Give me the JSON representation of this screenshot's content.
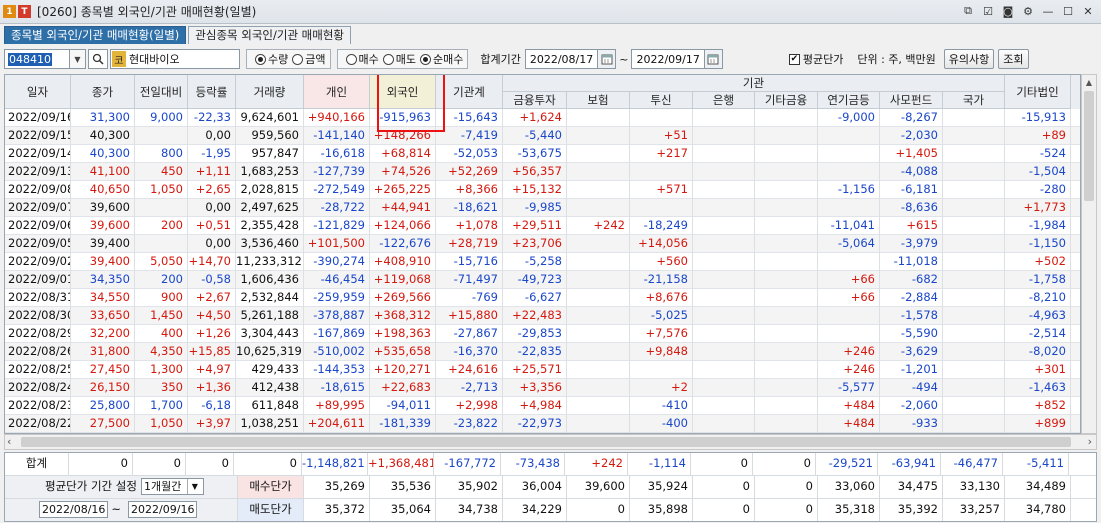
{
  "window": {
    "title": "[0260] 종목별 외국인/기관 매매현황(일별)",
    "badge1": "1",
    "badge2": "T"
  },
  "tabs": [
    {
      "label": "종목별 외국인/기관 매매현황(일별)",
      "active": true
    },
    {
      "label": "관심종목 외국인/기관 매매현황",
      "active": false
    }
  ],
  "toolbar": {
    "code": "048410",
    "stock_badge": "코",
    "stock_name": "현대바이오",
    "radio_group1": [
      {
        "label": "수량",
        "on": true
      },
      {
        "label": "금액",
        "on": false
      }
    ],
    "radio_group2": [
      {
        "label": "매수",
        "on": false
      },
      {
        "label": "매도",
        "on": false
      },
      {
        "label": "순매수",
        "on": true
      }
    ],
    "period_label": "합계기간",
    "date_from": "2022/08/17",
    "tilde": "~",
    "date_to": "2022/09/17",
    "avg_check_label": "평균단가",
    "unit_label": "단위 : 주, 백만원",
    "notice_btn": "유의사항",
    "query_btn": "조회"
  },
  "grid": {
    "group_header": "기관",
    "headers": [
      "일자",
      "종가",
      "전일대비",
      "등락률",
      "거래량",
      "개인",
      "외국인",
      "기관계",
      "금융투자",
      "보험",
      "투신",
      "은행",
      "기타금융",
      "연기금등",
      "사모펀드",
      "국가",
      "기타법인"
    ],
    "rows": [
      [
        "2022/09/16",
        "31,300",
        "9,000",
        "-22,33",
        "9,624,601",
        "+940,166",
        "-915,963",
        "-15,643",
        "+1,624",
        "",
        "",
        "",
        "",
        "-9,000",
        "-8,267",
        "",
        "-15,913"
      ],
      [
        "2022/09/15",
        "40,300",
        "",
        "0,00",
        "959,560",
        "-141,140",
        "+148,266",
        "-7,419",
        "-5,440",
        "",
        "+51",
        "",
        "",
        "",
        "-2,030",
        "",
        "+89"
      ],
      [
        "2022/09/14",
        "40,300",
        "800",
        "-1,95",
        "957,847",
        "-16,618",
        "+68,814",
        "-52,053",
        "-53,675",
        "",
        "+217",
        "",
        "",
        "",
        "+1,405",
        "",
        "-524"
      ],
      [
        "2022/09/13",
        "41,100",
        "450",
        "+1,11",
        "1,683,253",
        "-127,739",
        "+74,526",
        "+52,269",
        "+56,357",
        "",
        "",
        "",
        "",
        "",
        "-4,088",
        "",
        "-1,504"
      ],
      [
        "2022/09/08",
        "40,650",
        "1,050",
        "+2,65",
        "2,028,815",
        "-272,549",
        "+265,225",
        "+8,366",
        "+15,132",
        "",
        "+571",
        "",
        "",
        "-1,156",
        "-6,181",
        "",
        "-280"
      ],
      [
        "2022/09/07",
        "39,600",
        "",
        "0,00",
        "2,497,625",
        "-28,722",
        "+44,941",
        "-18,621",
        "-9,985",
        "",
        "",
        "",
        "",
        "",
        "-8,636",
        "",
        "+1,773"
      ],
      [
        "2022/09/06",
        "39,600",
        "200",
        "+0,51",
        "2,355,428",
        "-121,829",
        "+124,066",
        "+1,078",
        "+29,511",
        "+242",
        "-18,249",
        "",
        "",
        "-11,041",
        "+615",
        "",
        "-1,984"
      ],
      [
        "2022/09/05",
        "39,400",
        "",
        "0,00",
        "3,536,460",
        "+101,500",
        "-122,676",
        "+28,719",
        "+23,706",
        "",
        "+14,056",
        "",
        "",
        "-5,064",
        "-3,979",
        "",
        "-1,150"
      ],
      [
        "2022/09/02",
        "39,400",
        "5,050",
        "+14,70",
        "11,233,312",
        "-390,274",
        "+408,910",
        "-15,716",
        "-5,258",
        "",
        "+560",
        "",
        "",
        "",
        "-11,018",
        "",
        "+502"
      ],
      [
        "2022/09/01",
        "34,350",
        "200",
        "-0,58",
        "1,606,436",
        "-46,454",
        "+119,068",
        "-71,497",
        "-49,723",
        "",
        "-21,158",
        "",
        "",
        "+66",
        "-682",
        "",
        "-1,758"
      ],
      [
        "2022/08/31",
        "34,550",
        "900",
        "+2,67",
        "2,532,844",
        "-259,959",
        "+269,566",
        "-769",
        "-6,627",
        "",
        "+8,676",
        "",
        "",
        "+66",
        "-2,884",
        "",
        "-8,210"
      ],
      [
        "2022/08/30",
        "33,650",
        "1,450",
        "+4,50",
        "5,261,188",
        "-378,887",
        "+368,312",
        "+15,880",
        "+22,483",
        "",
        "-5,025",
        "",
        "",
        "",
        "-1,578",
        "",
        "-4,963"
      ],
      [
        "2022/08/29",
        "32,200",
        "400",
        "+1,26",
        "3,304,443",
        "-167,869",
        "+198,363",
        "-27,867",
        "-29,853",
        "",
        "+7,576",
        "",
        "",
        "",
        "-5,590",
        "",
        "-2,514"
      ],
      [
        "2022/08/26",
        "31,800",
        "4,350",
        "+15,85",
        "10,625,319",
        "-510,002",
        "+535,658",
        "-16,370",
        "-22,835",
        "",
        "+9,848",
        "",
        "",
        "+246",
        "-3,629",
        "",
        "-8,020"
      ],
      [
        "2022/08/25",
        "27,450",
        "1,300",
        "+4,97",
        "429,433",
        "-144,353",
        "+120,271",
        "+24,616",
        "+25,571",
        "",
        "",
        "",
        "",
        "+246",
        "-1,201",
        "",
        "+301"
      ],
      [
        "2022/08/24",
        "26,150",
        "350",
        "+1,36",
        "412,438",
        "-18,615",
        "+22,683",
        "-2,713",
        "+3,356",
        "",
        "+2",
        "",
        "",
        "-5,577",
        "-494",
        "",
        "-1,463"
      ],
      [
        "2022/08/23",
        "25,800",
        "1,700",
        "-6,18",
        "611,848",
        "+89,995",
        "-94,011",
        "+2,998",
        "+4,984",
        "",
        "-410",
        "",
        "",
        "+484",
        "-2,060",
        "",
        "+852"
      ],
      [
        "2022/08/22",
        "27,500",
        "1,050",
        "+3,97",
        "1,038,251",
        "+204,611",
        "-181,339",
        "-23,822",
        "-22,973",
        "",
        "-400",
        "",
        "",
        "+484",
        "-933",
        "",
        "+899"
      ]
    ]
  },
  "totals": {
    "label": "합계",
    "values": [
      "0",
      "0",
      "0",
      "0",
      "-1,148,821",
      "+1,368,481",
      "-167,772",
      "-73,438",
      "+242",
      "-1,114",
      "0",
      "0",
      "-29,521",
      "-63,941",
      "-46,477",
      "-5,411"
    ]
  },
  "avg": {
    "setting_label": "평균단가 기간 설정",
    "period_select": "1개월간",
    "from": "2022/08/16",
    "to": "2022/09/16",
    "buy_label": "매수단가",
    "sell_label": "매도단가",
    "buy_values": [
      "35,269",
      "35,536",
      "35,902",
      "36,004",
      "39,600",
      "35,924",
      "0",
      "0",
      "33,060",
      "34,475",
      "33,130",
      "34,489"
    ],
    "sell_values": [
      "35,372",
      "35,064",
      "34,738",
      "34,229",
      "0",
      "35,898",
      "0",
      "0",
      "35,318",
      "35,392",
      "33,257",
      "34,780"
    ]
  },
  "colors": {
    "up": "#d4180e",
    "down": "#1a46c8",
    "active_tab": "#2f6fa8",
    "highlight_box": "#ee1111"
  }
}
